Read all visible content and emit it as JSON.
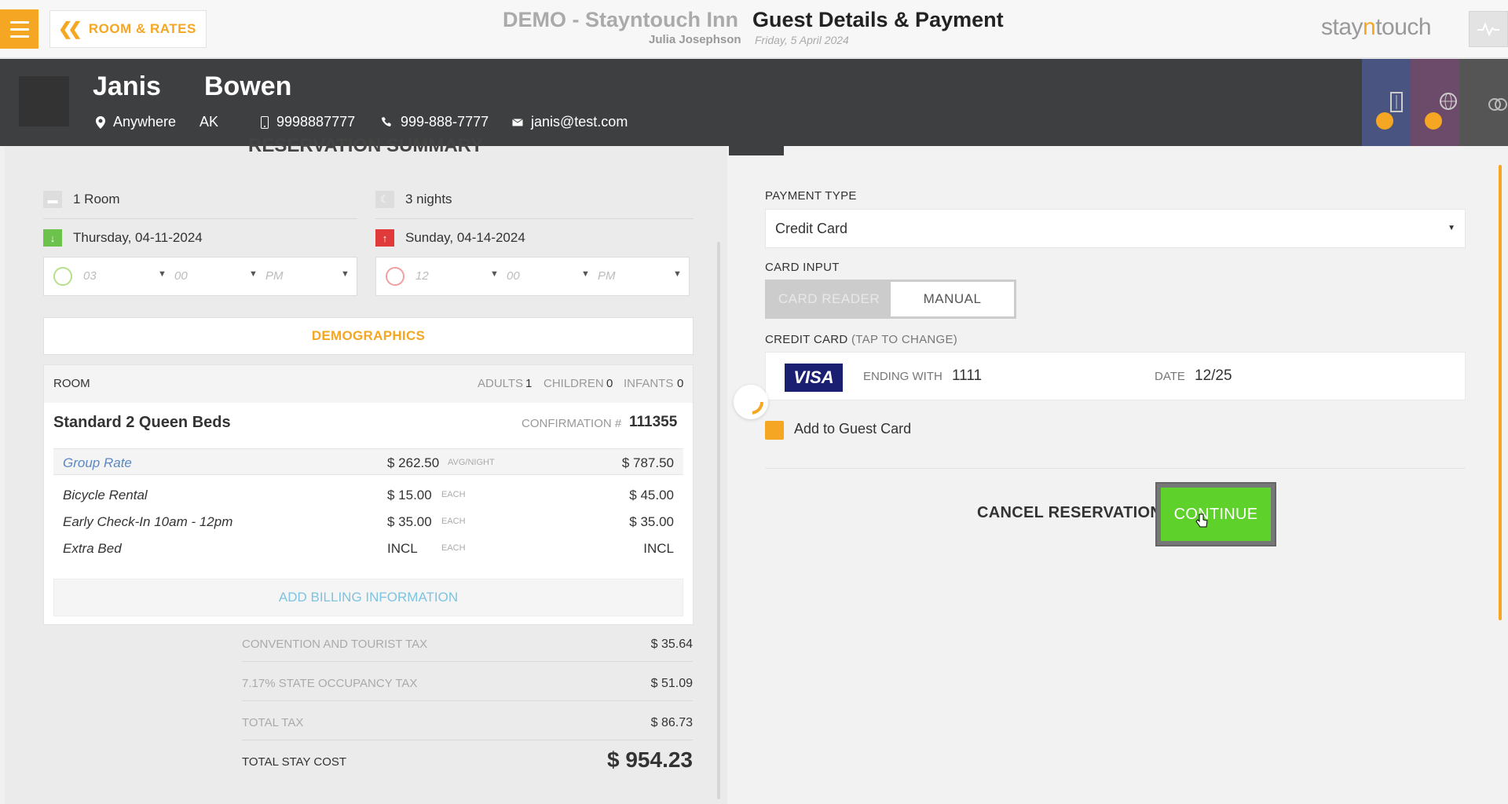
{
  "topbar": {
    "back_label": "ROOM & RATES",
    "hotel_name": "DEMO - Stayntouch Inn",
    "page_title": "Guest Details & Payment",
    "user_name": "Julia Josephson",
    "date": "Friday, 5 April 2024",
    "logo_part1": "stay",
    "logo_part2": "n",
    "logo_part3": "touch"
  },
  "guest": {
    "first_name": "Janis",
    "last_name": "Bowen",
    "city": "Anywhere",
    "state": "AK",
    "mobile": "9998887777",
    "phone": "999-888-7777",
    "email": "janis@test.com"
  },
  "summary": {
    "title": "RESERVATION SUMMARY",
    "rooms": "1 Room",
    "nights": "3 nights",
    "arrival_date": "Thursday, 04-11-2024",
    "departure_date": "Sunday, 04-14-2024",
    "arrival_time": {
      "hour": "03",
      "minute": "00",
      "ampm": "PM"
    },
    "departure_time": {
      "hour": "12",
      "minute": "00",
      "ampm": "PM"
    },
    "demographics_label": "DEMOGRAPHICS",
    "room_label": "ROOM",
    "adults_label": "ADULTS",
    "adults": "1",
    "children_label": "CHILDREN",
    "children": "0",
    "infants_label": "INFANTS",
    "infants": "0",
    "room_type": "Standard 2 Queen Beds",
    "confirmation_label": "CONFIRMATION #",
    "confirmation": "111355",
    "rate": {
      "name": "Group Rate",
      "price": "$ 262.50",
      "unit": "AVG/NIGHT",
      "total": "$ 787.50"
    },
    "addons": [
      {
        "name": "Bicycle Rental",
        "price": "$ 15.00",
        "unit": "EACH",
        "total": "$ 45.00"
      },
      {
        "name": "Early Check-In 10am - 12pm",
        "price": "$ 35.00",
        "unit": "EACH",
        "total": "$ 35.00"
      },
      {
        "name": "Extra Bed",
        "price": "INCL",
        "unit": "EACH",
        "total": "INCL"
      }
    ],
    "add_billing_label": "ADD BILLING INFORMATION",
    "taxes": [
      {
        "label": "CONVENTION AND TOURIST TAX",
        "value": "$ 35.64"
      },
      {
        "label": "7.17% STATE OCCUPANCY TAX",
        "value": "$ 51.09"
      },
      {
        "label": "TOTAL TAX",
        "value": "$ 86.73"
      }
    ],
    "total_label": "TOTAL STAY COST",
    "total": "$ 954.23"
  },
  "payment": {
    "type_label": "PAYMENT TYPE",
    "type_value": "Credit Card",
    "card_input_label": "CARD INPUT",
    "card_reader_label": "CARD READER",
    "manual_label": "MANUAL",
    "credit_card_label": "CREDIT CARD",
    "tap_to_change": "(TAP TO CHANGE)",
    "card_brand": "VISA",
    "ending_label": "ENDING WITH",
    "ending": "1111",
    "date_label": "DATE",
    "expiry": "12/25",
    "add_guest_card_label": "Add to Guest Card",
    "cancel_label": "CANCEL RESERVATION",
    "continue_label": "CONTINUE"
  },
  "colors": {
    "accent": "#f5a623",
    "continue": "#5ed12a",
    "header": "#3d3f41"
  }
}
